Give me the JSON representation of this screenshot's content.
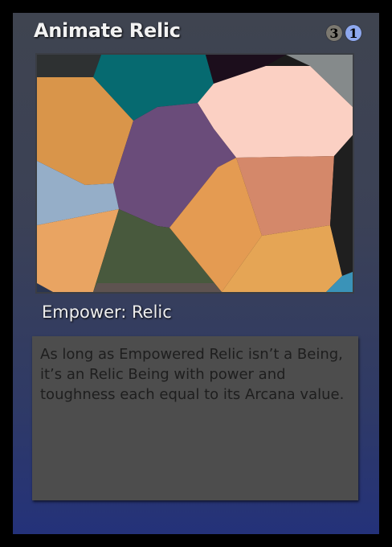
{
  "card": {
    "name": "Animate Relic",
    "cost": [
      {
        "value": "3",
        "type": "generic",
        "color": "#7b7870"
      },
      {
        "value": "1",
        "type": "blue",
        "color": "#8ea8ee"
      }
    ],
    "type_line": "Empower: Relic",
    "rules_text": "As long as Empowered Relic isn’t a Being, it’s an Relic Being with power and toughness each equal to its Arcana value."
  },
  "art_palette": {
    "orange": "#d9954a",
    "teal": "#066a70",
    "purple": "#6a4c7a",
    "peach": "#fbd0c3",
    "salmon": "#d4886a",
    "slate_blue": "#95aec8",
    "green": "#48593d",
    "gray": "#858a8b",
    "dark": "#1b1b1b"
  }
}
